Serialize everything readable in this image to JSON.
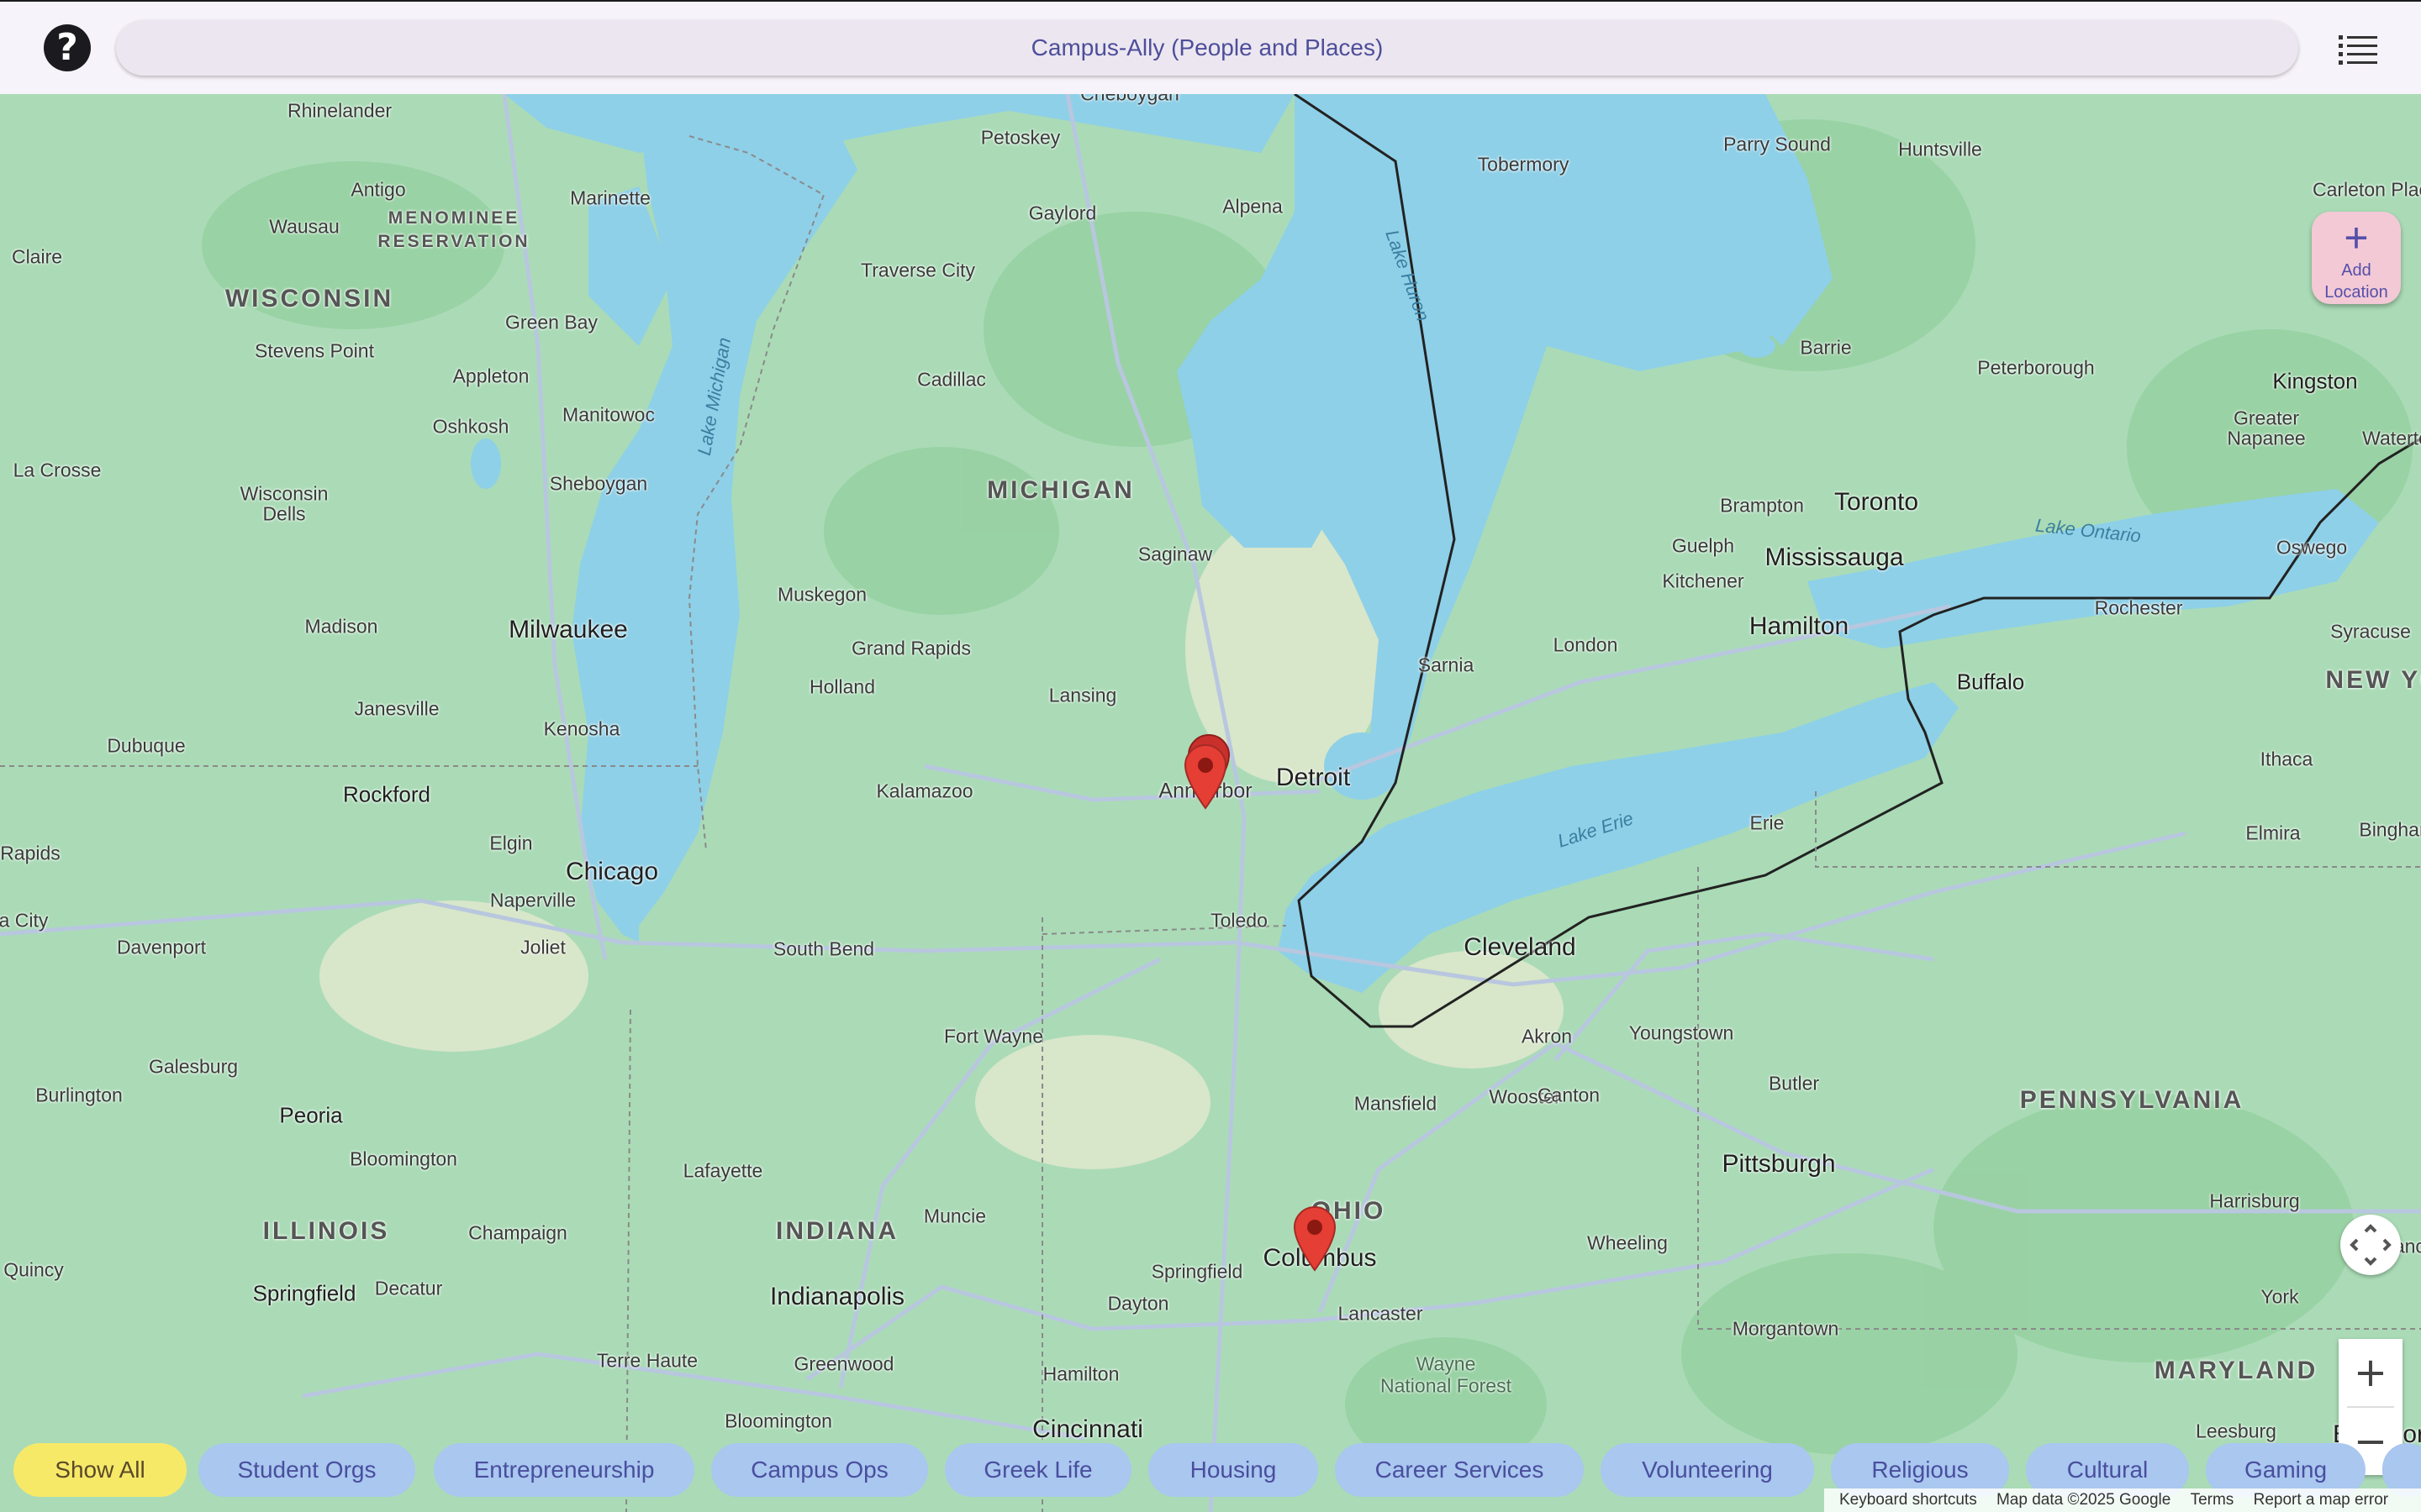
{
  "header": {
    "help_icon": "help-circle-icon",
    "title": "Campus-Ally (People and Places)",
    "menu_icon": "list-icon"
  },
  "map": {
    "add_location": {
      "icon": "plus-icon",
      "label_line1": "Add",
      "label_line2": "Location"
    },
    "locate_icon": "recenter-icon",
    "zoom_in": "+",
    "zoom_out": "−",
    "labels": {
      "rhinelander": "Rhinelander",
      "cheboygan": "Cheboygan",
      "petoskey": "Petoskey",
      "antigo": "Antigo",
      "marinette": "Marinette",
      "menominee": "MENOMINEE",
      "reservation": "RESERVATION",
      "wausau": "Wausau",
      "gaylord": "Gaylord",
      "alpena": "Alpena",
      "tobermory": "Tobermory",
      "parry_sound": "Parry Sound",
      "huntsville": "Huntsville",
      "carleton_place": "Carleton Plac",
      "eau_claire": "Claire",
      "wisconsin": "WISCONSIN",
      "traverse_city": "Traverse City",
      "green_bay": "Green Bay",
      "stevens_point": "Stevens Point",
      "appleton": "Appleton",
      "cadillac": "Cadillac",
      "barrie": "Barrie",
      "peterborough": "Peterborough",
      "kingston": "Kingston",
      "oshkosh": "Oshkosh",
      "manitowoc": "Manitowoc",
      "greater_napanee": "Greater",
      "napanee": "Napanee",
      "watertown": "Waterto",
      "la_crosse": "La Crosse",
      "wisconsin_dells": "Wisconsin",
      "dells": "Dells",
      "sheboygan": "Sheboygan",
      "michigan": "MICHIGAN",
      "brampton": "Brampton",
      "toronto": "Toronto",
      "guelph": "Guelph",
      "mississauga": "Mississauga",
      "kitchener": "Kitchener",
      "lake_ontario": "Lake Ontario",
      "oswego": "Oswego",
      "saginaw": "Saginaw",
      "muskegon": "Muskegon",
      "madison": "Madison",
      "milwaukee": "Milwaukee",
      "grand_rapids": "Grand Rapids",
      "hamilton": "Hamilton",
      "rochester": "Rochester",
      "syracuse": "Syracuse",
      "holland": "Holland",
      "sarnia": "Sarnia",
      "london": "London",
      "lansing": "Lansing",
      "janesville": "Janesville",
      "kenosha": "Kenosha",
      "buffalo": "Buffalo",
      "new_york": "NEW YO",
      "dubuque": "Dubuque",
      "detroit": "Detroit",
      "ann_arbor": "Ann Arbor",
      "kalamazoo": "Kalamazoo",
      "rockford": "Rockford",
      "ithaca": "Ithaca",
      "erie": "Erie",
      "lake_erie": "Lake Erie",
      "binghamton": "Binghar",
      "elmira": "Elmira",
      "rapids": "Rapids",
      "elgin": "Elgin",
      "chicago": "Chicago",
      "naperville": "Naperville",
      "toledo": "Toledo",
      "city": "a City",
      "davenport": "Davenport",
      "joliet": "Joliet",
      "south_bend": "South Bend",
      "cleveland": "Cleveland",
      "fort_wayne": "Fort Wayne",
      "akron": "Akron",
      "youngstown": "Youngstown",
      "galesburg": "Galesburg",
      "burlington": "Burlington",
      "butler": "Butler",
      "peoria": "Peoria",
      "mansfield": "Mansfield",
      "wooster": "Wooster",
      "canton": "Canton",
      "pennsylvania": "PENNSYLVANIA",
      "bloomington_il": "Bloomington",
      "pittsburgh": "Pittsburgh",
      "lafayette": "Lafayette",
      "ohio": "OHIO",
      "harrisburg": "Harrisburg",
      "illinois": "ILLINOIS",
      "indiana": "INDIANA",
      "muncie": "Muncie",
      "champaign": "Champaign",
      "wheeling": "Wheeling",
      "lancaster_pa": "Lanc",
      "quincy": "Quincy",
      "springfield_oh": "Springfield",
      "columbus": "Columbus",
      "york": "York",
      "springfield_il": "Springfield",
      "decatur": "Decatur",
      "indianapolis": "Indianapolis",
      "dayton": "Dayton",
      "lancaster": "Lancaster",
      "morgantown": "Morgantown",
      "terre_haute": "Terre Haute",
      "greenwood": "Greenwood",
      "wayne": "Wayne",
      "national_forest": "National Forest",
      "maryland": "MARYLAND",
      "hamilton_oh": "Hamilton",
      "bloomington_in": "Bloomington",
      "cincinnati": "Cincinnati",
      "leesburg": "Leesburg",
      "baltimore": "Baltimor",
      "lake_michigan": "Lake Michigan",
      "lake_huron": "Lake Huron"
    },
    "markers": [
      "Ann Arbor",
      "Ann Arbor",
      "Columbus"
    ]
  },
  "filters": {
    "chips": [
      "Show All",
      "Student Orgs",
      "Entrepreneurship",
      "Campus Ops",
      "Greek Life",
      "Housing",
      "Career Services",
      "Volunteering",
      "Religious",
      "Cultural",
      "Gaming"
    ],
    "selected": "Show All"
  },
  "attribution": {
    "keyboard": "Keyboard shortcuts",
    "data": "Map data ©2025 Google",
    "terms": "Terms",
    "report": "Report a map error"
  }
}
